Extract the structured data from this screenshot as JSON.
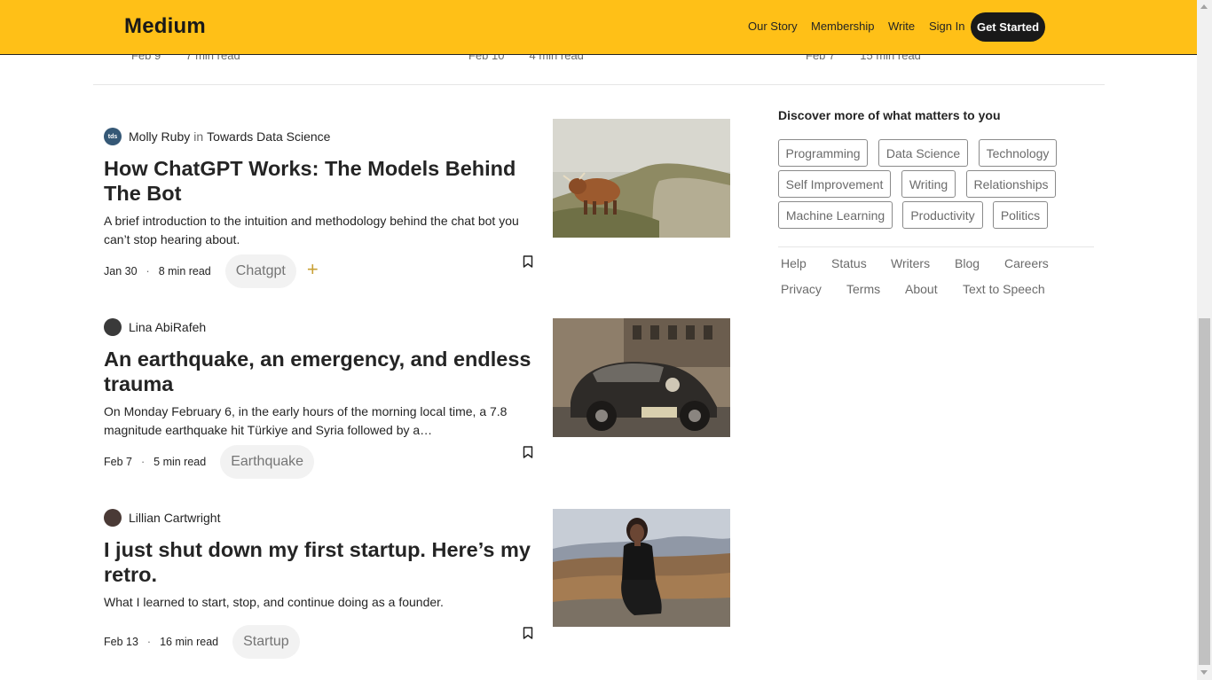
{
  "header": {
    "logo": "Medium",
    "nav": [
      "Our Story",
      "Membership",
      "Write",
      "Sign In"
    ],
    "cta": "Get Started"
  },
  "trending": [
    {
      "date": "Feb 9",
      "read_time": "7 min read"
    },
    {
      "date": "Feb 10",
      "read_time": "4 min read"
    },
    {
      "date": "Feb 7",
      "read_time": "15 min read"
    }
  ],
  "articles": [
    {
      "avatar_text": "tds",
      "author": "Molly Ruby",
      "in_label": "in",
      "publication": "Towards Data Science",
      "title": "How ChatGPT Works: The Models Behind The Bot",
      "subtitle": "A brief introduction to the intuition and methodology behind the chat bot you can’t stop hearing about.",
      "date": "Jan 30",
      "read_time": "8 min read",
      "tag": "Chatgpt",
      "image": "highland-cow-photo"
    },
    {
      "author": "Lina AbiRafeh",
      "title": "An earthquake, an emergency, and endless trauma",
      "subtitle": "On Monday February 6, in the early hours of the morning local time, a 7.8 magnitude earthquake hit Türkiye and Syria followed by a…",
      "date": "Feb 7",
      "read_time": "5 min read",
      "tag": "Earthquake",
      "image": "vintage-car-photo"
    },
    {
      "author": "Lillian Cartwright",
      "title": "I just shut down my first startup. Here’s my retro.",
      "subtitle": "What I learned to start, stop, and continue doing as a founder.",
      "date": "Feb 13",
      "read_time": "16 min read",
      "tag": "Startup",
      "image": "woman-on-mountain-photo"
    }
  ],
  "sidebar": {
    "heading": "Discover more of what matters to you",
    "topics": [
      "Programming",
      "Data Science",
      "Technology",
      "Self Improvement",
      "Writing",
      "Relationships",
      "Machine Learning",
      "Productivity",
      "Politics"
    ],
    "footer_links": [
      "Help",
      "Status",
      "Writers",
      "Blog",
      "Careers",
      "Privacy",
      "Terms",
      "About",
      "Text to Speech"
    ]
  },
  "colors": {
    "brand": "#ffc017",
    "text": "#242424",
    "muted": "#6b6b6b",
    "accent_plus": "#c8a035"
  }
}
